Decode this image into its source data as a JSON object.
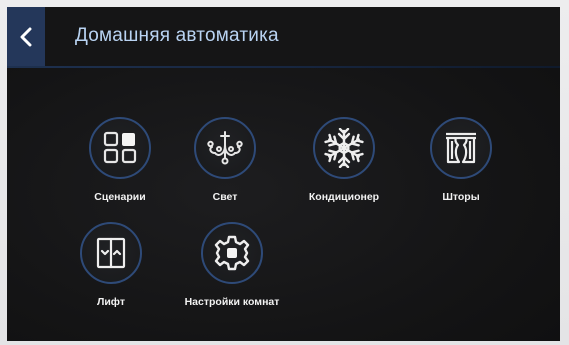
{
  "header": {
    "back_icon": "chevron-left-icon",
    "title": "Домашняя автоматика"
  },
  "colors": {
    "accent_blue": "#24375a",
    "circle_border": "#2e4a78",
    "title_text": "#b9d3f2",
    "label_text": "#f2f2f2",
    "background": "#141415"
  },
  "tiles": [
    {
      "label": "Сценарии",
      "icon": "scenes-grid-icon"
    },
    {
      "label": "Свет",
      "icon": "chandelier-icon"
    },
    {
      "label": "Кондиционер",
      "icon": "snowflake-icon"
    },
    {
      "label": "Шторы",
      "icon": "curtains-icon"
    },
    {
      "label": "Лифт",
      "icon": "elevator-icon"
    },
    {
      "label": "Настройки комнат",
      "icon": "gear-icon"
    }
  ]
}
